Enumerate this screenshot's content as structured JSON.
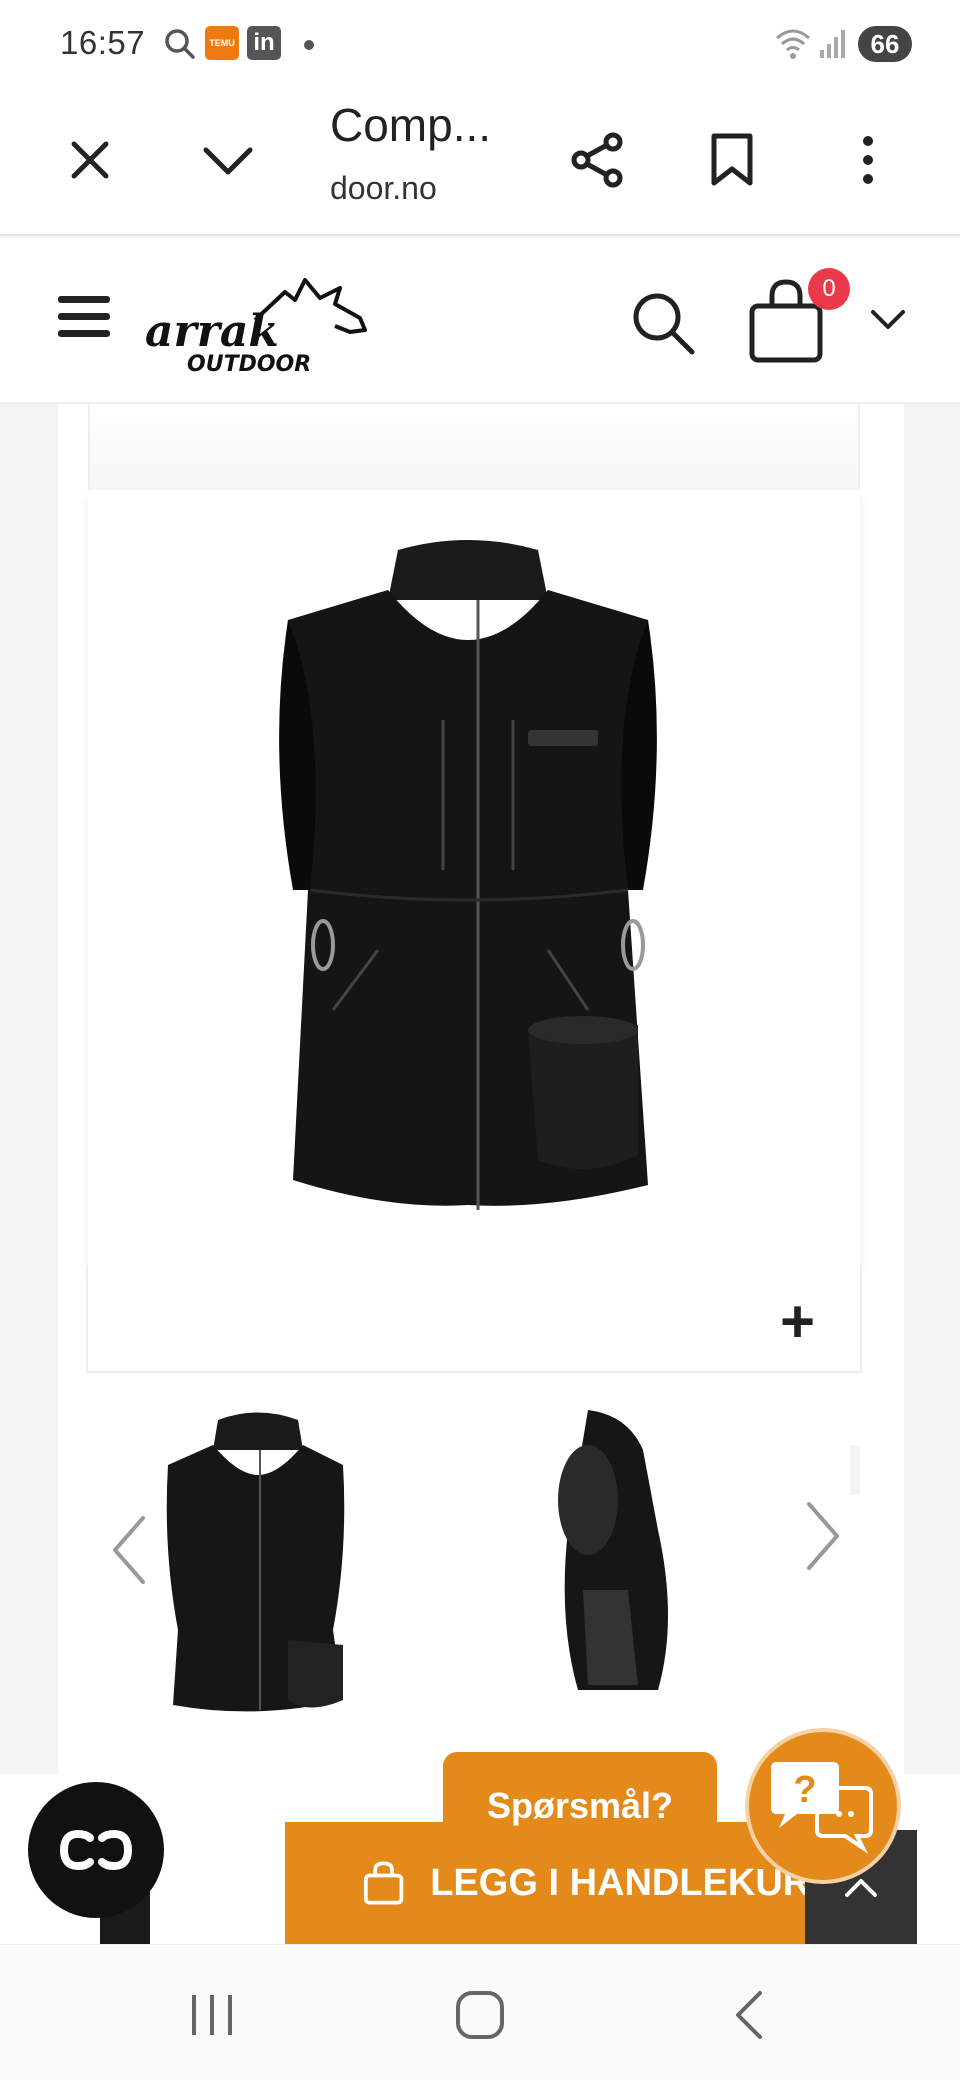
{
  "status_bar": {
    "time": "16:57",
    "temu_label": "TEMU",
    "linkedin_label": "in",
    "battery": "66"
  },
  "browser": {
    "title": "Comp...",
    "url": "door.no"
  },
  "site": {
    "logo_text_top": "arrak",
    "logo_text_bottom": "OUTDOOR",
    "cart_count": "0"
  },
  "product": {
    "zoom_symbol": "+"
  },
  "actions": {
    "question_label": "Spørsmål?",
    "add_to_cart_label": "LEGG I HANDLEKURV",
    "chat_symbol": "?"
  },
  "colors": {
    "accent": "#e38a1b",
    "badge": "#e9394a",
    "dark": "#333333"
  }
}
